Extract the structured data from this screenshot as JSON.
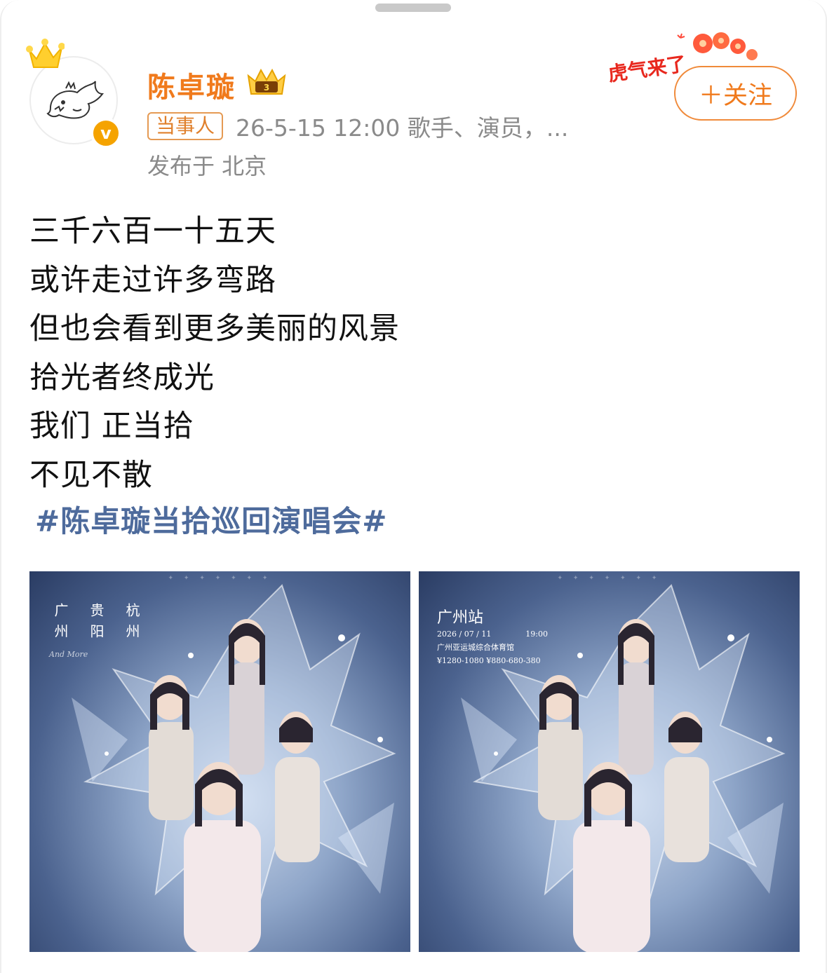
{
  "header": {
    "username": "陈卓璇",
    "tag": "当事人",
    "meta": "26-5-15 12:00 歌手、演员，...",
    "location": "发布于 北京",
    "follow_label": "＋关注",
    "decoration_text": "虎气来了"
  },
  "post": {
    "lines": [
      "三千六百一十五天",
      "或许走过许多弯路",
      "但也会看到更多美丽的风景",
      "拾光者终成光",
      "我们 正当拾",
      "不见不散"
    ],
    "hashtag": "#陈卓璇当拾巡回演唱会#"
  },
  "images": [
    {
      "cities": [
        "广州",
        "贵阳",
        "杭州"
      ],
      "and_more": "And More"
    },
    {
      "station": "广州站",
      "date": "2026 / 07 / 11",
      "time": "19:00",
      "venue": "广州亚运城综合体育馆",
      "prices": "¥1280-1080 ¥880-680-380"
    }
  ],
  "colors": {
    "username": "#f07a1c",
    "hashtag": "#4e6b9c",
    "meta": "#8a8a8a",
    "verified": "#f5a300"
  }
}
